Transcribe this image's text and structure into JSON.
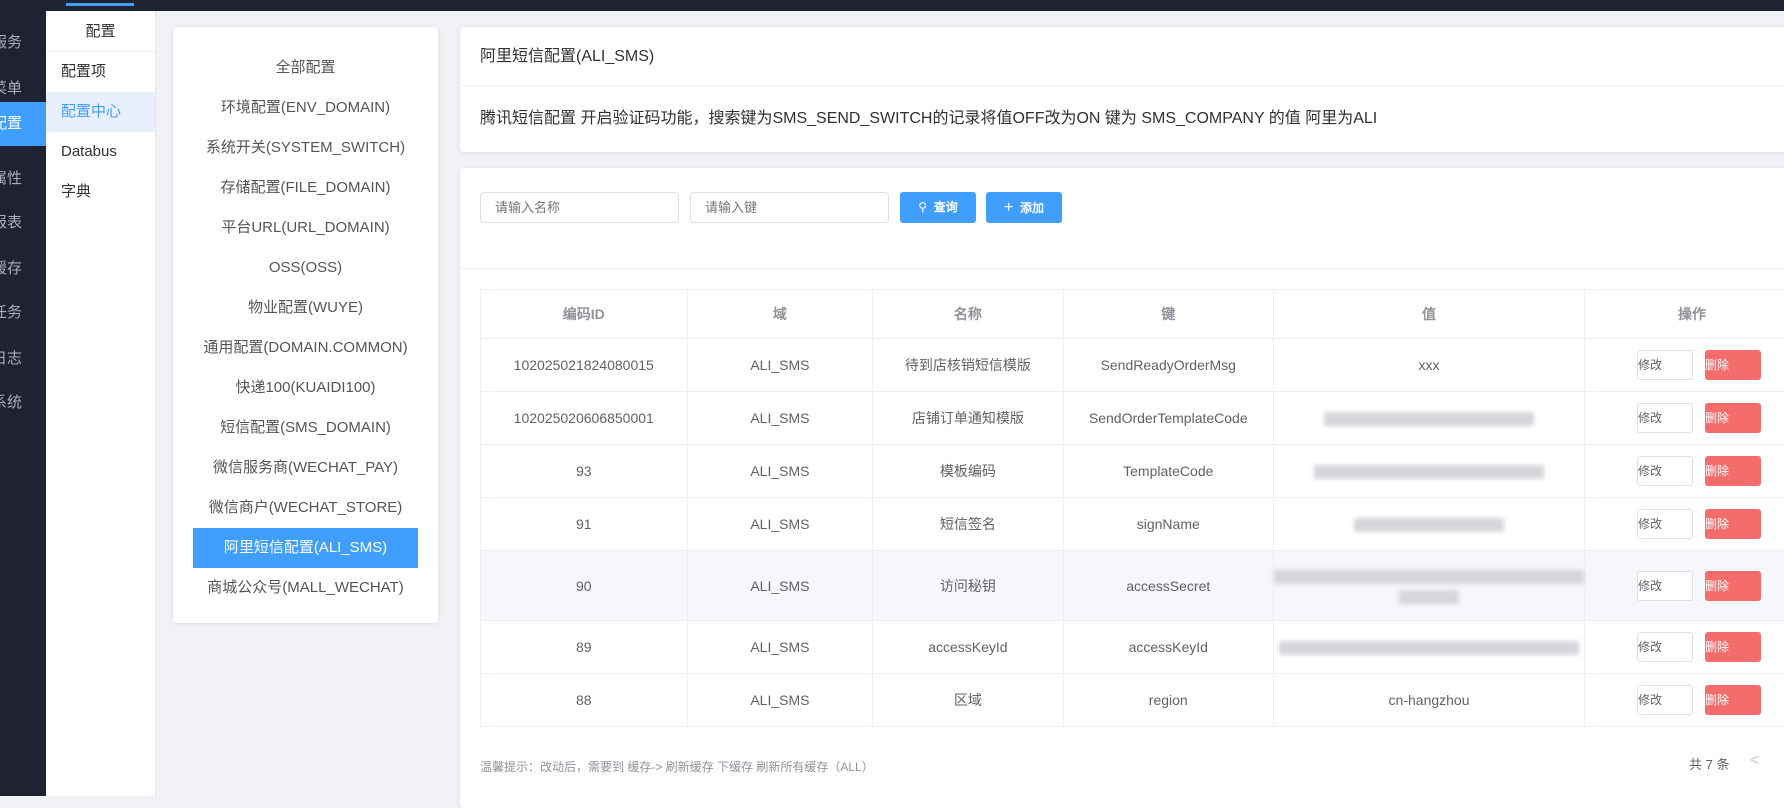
{
  "nav1": {
    "items": [
      {
        "label": "服务"
      },
      {
        "label": "菜单"
      },
      {
        "label": "配置",
        "active": true
      },
      {
        "label": "属性"
      },
      {
        "label": "报表"
      },
      {
        "label": "缓存"
      },
      {
        "label": "任务"
      },
      {
        "label": "日志"
      },
      {
        "label": "系统"
      }
    ]
  },
  "nav2": {
    "title": "配置",
    "items": [
      {
        "label": "配置项"
      },
      {
        "label": "配置中心",
        "active": true
      },
      {
        "label": "Databus"
      },
      {
        "label": "字典"
      }
    ]
  },
  "config_list": [
    "全部配置",
    "环境配置(ENV_DOMAIN)",
    "系统开关(SYSTEM_SWITCH)",
    "存储配置(FILE_DOMAIN)",
    "平台URL(URL_DOMAIN)",
    "OSS(OSS)",
    "物业配置(WUYE)",
    "通用配置(DOMAIN.COMMON)",
    "快递100(KUAIDI100)",
    "短信配置(SMS_DOMAIN)",
    "微信服务商(WECHAT_PAY)",
    "微信商户(WECHAT_STORE)",
    "阿里短信配置(ALI_SMS)",
    "商城公众号(MALL_WECHAT)"
  ],
  "header": {
    "title": "阿里短信配置(ALI_SMS)",
    "description": "腾讯短信配置 开启验证码功能，搜索键为SMS_SEND_SWITCH的记录将值OFF改为ON 键为 SMS_COMPANY 的值 阿里为ALI"
  },
  "search": {
    "name_placeholder": "请输入名称",
    "key_placeholder": "请输入键",
    "query_label": "查询",
    "add_label": "添加"
  },
  "table": {
    "columns": [
      "编码ID",
      "域",
      "名称",
      "键",
      "值",
      "操作"
    ],
    "edit_label": "修改",
    "delete_label": "删除",
    "rows": [
      {
        "id": "102025021824080015",
        "domain": "ALI_SMS",
        "name": "待到店核销短信模版",
        "key": "SendReadyOrderMsg",
        "value": "xxx"
      },
      {
        "id": "102025020606850001",
        "domain": "ALI_SMS",
        "name": "店铺订单通知模版",
        "key": "SendOrderTemplateCode",
        "value": null
      },
      {
        "id": "93",
        "domain": "ALI_SMS",
        "name": "模板编码",
        "key": "TemplateCode",
        "value": null
      },
      {
        "id": "91",
        "domain": "ALI_SMS",
        "name": "短信签名",
        "key": "signName",
        "value": null
      },
      {
        "id": "90",
        "domain": "ALI_SMS",
        "name": "访问秘钥",
        "key": "accessSecret",
        "value": null
      },
      {
        "id": "89",
        "domain": "ALI_SMS",
        "name": "accessKeyId",
        "key": "accessKeyId",
        "value": null
      },
      {
        "id": "88",
        "domain": "ALI_SMS",
        "name": "区域",
        "key": "region",
        "value": "cn-hangzhou"
      }
    ]
  },
  "footer": {
    "tip": "温馨提示：改动后，需要到 缓存-> 刷新缓存 下缓存 刷新所有缓存（ALL）",
    "total": "共 7 条",
    "prev": "<"
  }
}
